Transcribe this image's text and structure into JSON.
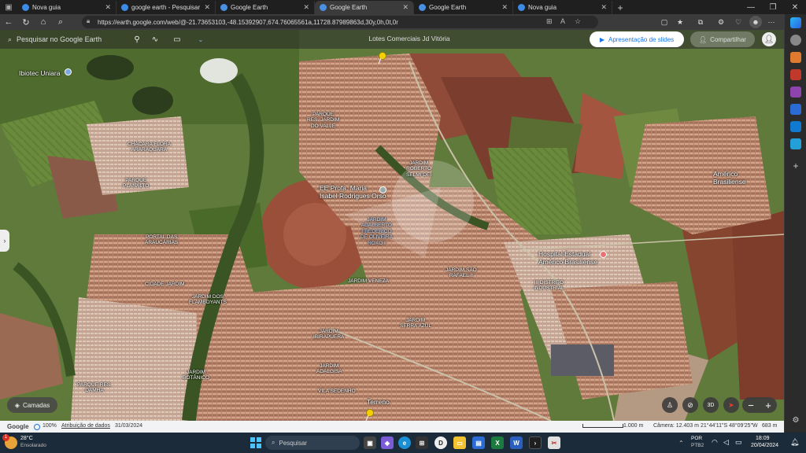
{
  "browser": {
    "tabs": [
      {
        "title": "Nova guia",
        "fav": "#3c8ce7",
        "active": false
      },
      {
        "title": "google earth - Pesquisar",
        "fav": "#3c8ce7",
        "active": false
      },
      {
        "title": "Google Earth",
        "fav": "#4a90e2",
        "active": false
      },
      {
        "title": "Google Earth",
        "fav": "#4a90e2",
        "active": true
      },
      {
        "title": "Google Earth",
        "fav": "#4a90e2",
        "active": false
      },
      {
        "title": "Nova guia",
        "fav": "#3c8ce7",
        "active": false
      }
    ],
    "new_tab": "+",
    "url": "https://earth.google.com/web/@-21.73653103,-48.15392907,674.76065561a,11728.87989863d,30y,0h,0t,0r"
  },
  "earth": {
    "search_placeholder": "Pesquisar no Google Earth",
    "doc_title": "Lotes Comerciais Jd Vitória",
    "slides_label": "Apresentação de slides",
    "share_label": "Compartilhar",
    "layers_label": "Camadas",
    "view_3d_label": "3D",
    "zoom_minus": "−",
    "zoom_plus": "+",
    "status": {
      "brand": "Google",
      "percent": "100%",
      "attribution": "Atribuição de dados",
      "date": "31/03/2024",
      "scale": "1.000 m",
      "camera": "Câmera: 12.403 m",
      "coords": "21°44'11\"S 48°09'25\"W",
      "elevation": "683 m"
    }
  },
  "map_labels": {
    "ibiotec": "Ibiotec Uniara",
    "parque_res_jardim_do_valle": "PARQUE\nRES. JARDIM\nDO VALLE",
    "chacara_flora": "CHÁCARA FLORA\nARARAQUARA",
    "parque_planalto": "PARQUE\nPLANALTO",
    "jardim_roberto": "JARDIM\nROBERTO\nSELMI DEI",
    "ee_profa": "EE Profa. Maria\nIsabel Rodrigues Orso",
    "jardim_adalberto": "JARDIM\nADALBERTO\nFREDERICO\nDE OLIVEIRA\nROXO I",
    "portal_araucarias": "PORTAL DAS\nARAUCÁRIAS",
    "americo": "Américo\nBrasiliense",
    "hospital": "Hospital Estadual\nAmérico Brasiliense",
    "jardim_sao_rafael": "JARDIM SÃO\nRAFAEL II",
    "distrito_industrial": "III DISTRITO\nINDUSTRIAL",
    "cidade_jardim": "CIDADE JARDIM",
    "jardim_veneza": "JARDIM VENEZA",
    "jardim_flamboyants": "JARDIM DOS\nFLAMBOYANTS",
    "jardim_serra_azul": "JARDIM\nSERRA AZUL",
    "jardim_iguatemi": "JARDIM\nIBIRAPUERA",
    "jardim_adalgisa": "JARDIM\nADALGISA",
    "jardim_botanico": "JARDIM\nBOTÂNICO",
    "parque_res_damha": "PARQUE RES.\nDAMHA",
    "vila_sedenho": "VILA SEDENHO",
    "terreno": "Terreno"
  },
  "taskbar": {
    "weather_temp": "28°C",
    "weather_desc": "Ensolarado",
    "search_label": "Pesquisar",
    "lang": "POR",
    "lang_sub": "PTB2",
    "time": "18:09",
    "date": "20/04/2024",
    "notification_count": "1"
  }
}
